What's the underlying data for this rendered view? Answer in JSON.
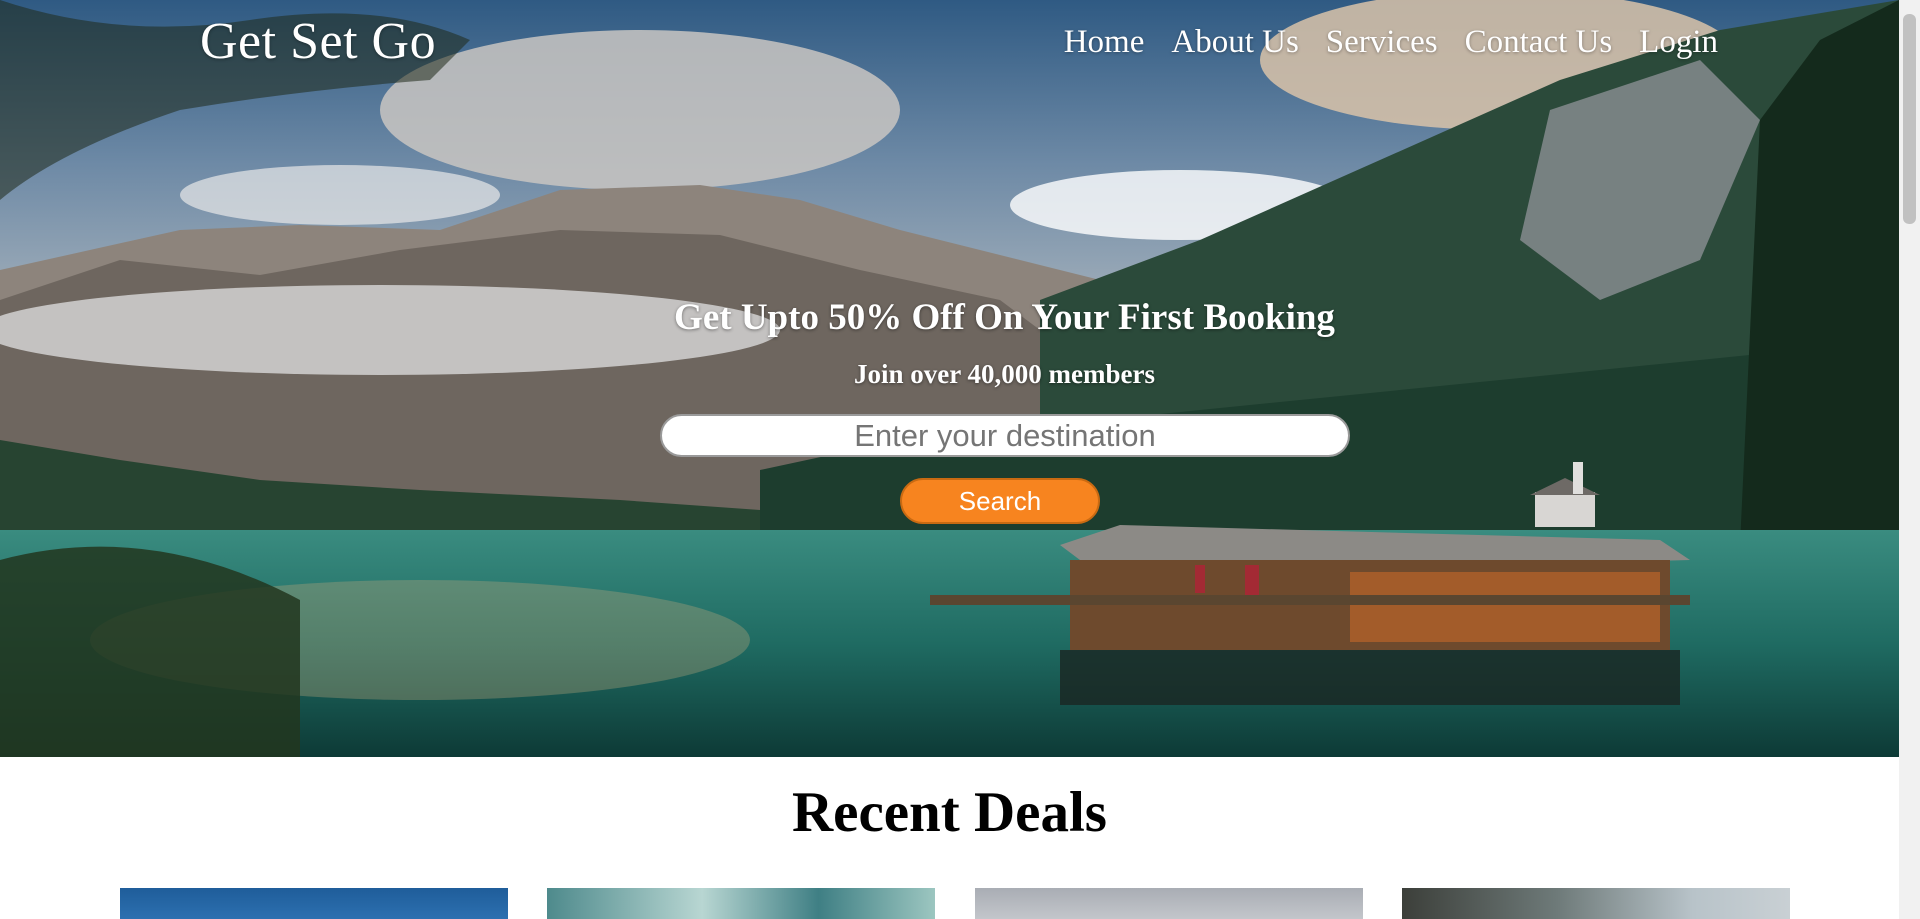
{
  "brand": {
    "name": "Get Set Go"
  },
  "nav": {
    "items": [
      {
        "label": "Home"
      },
      {
        "label": "About Us"
      },
      {
        "label": "Services"
      },
      {
        "label": "Contact Us"
      },
      {
        "label": "Login"
      }
    ]
  },
  "hero": {
    "headline": "Get Upto 50% Off On Your First Booking",
    "subheadline": "Join over 40,000 members",
    "search": {
      "placeholder": "Enter your destination",
      "value": ""
    },
    "search_button": "Search",
    "accent_color": "#f7841f"
  },
  "deals": {
    "title": "Recent Deals",
    "cards": [
      {
        "image": "blue-sky-photo"
      },
      {
        "image": "ocean-waves-photo"
      },
      {
        "image": "grey-sky-photo"
      },
      {
        "image": "tree-landscape-photo"
      }
    ]
  }
}
